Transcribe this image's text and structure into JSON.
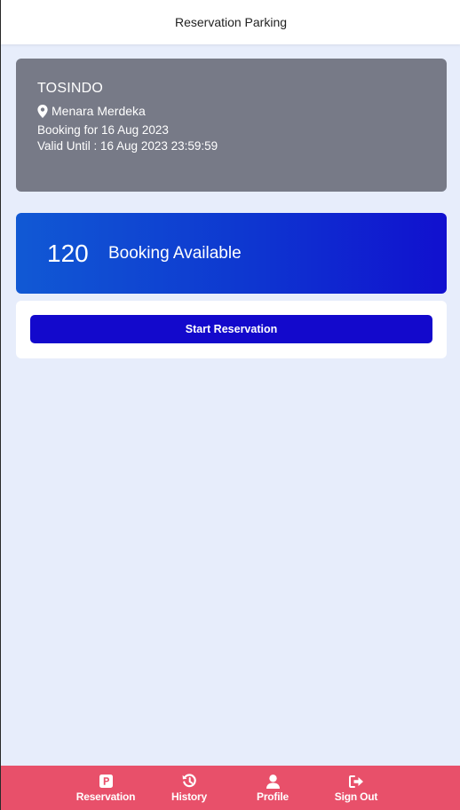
{
  "header": {
    "title": "Reservation Parking"
  },
  "info": {
    "company": "TOSINDO",
    "location": "Menara Merdeka",
    "booking_for": "Booking for 16 Aug 2023",
    "valid_until": "Valid Until : 16 Aug 2023 23:59:59"
  },
  "availability": {
    "count": "120",
    "label": "Booking Available"
  },
  "action": {
    "start_label": "Start Reservation"
  },
  "nav": {
    "items": [
      {
        "label": "Reservation",
        "icon": "parking-icon"
      },
      {
        "label": "History",
        "icon": "history-icon"
      },
      {
        "label": "Profile",
        "icon": "user-icon"
      },
      {
        "label": "Sign Out",
        "icon": "sign-out-icon"
      }
    ]
  },
  "colors": {
    "background": "#e7edfb",
    "info_card": "#777a87",
    "gradient_start": "#1159d4",
    "gradient_end": "#1110cf",
    "button": "#1309cc",
    "bottom_nav": "#e8506a"
  }
}
